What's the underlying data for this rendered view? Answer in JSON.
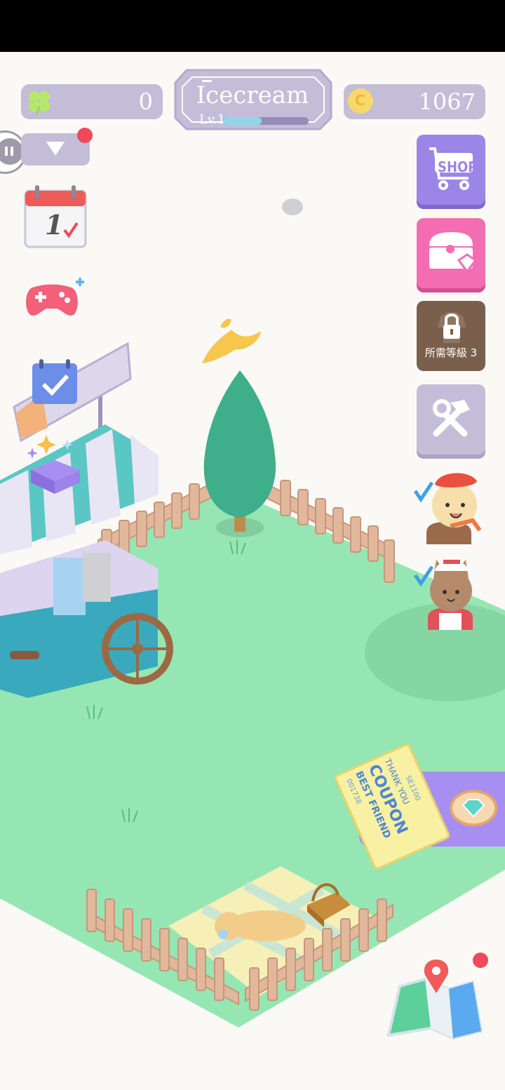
{
  "hud": {
    "clover_count": "0",
    "shop_name": "Icecream",
    "level_label": "Lv.1",
    "level_progress": 0.45,
    "coin_count": "1067",
    "coin_symbol": "C"
  },
  "side_buttons": {
    "calendar_day": "1",
    "shop_label": "SHOP",
    "wardrobe_lock_label": "所需等級 3"
  },
  "coupon": {
    "serial": "001738",
    "line1": "BEST FRIEND",
    "line2": "COUPON",
    "thanks": "THANK YOU",
    "code": "SE1100"
  },
  "colors": {
    "grass": "#96e6b3",
    "hud_purple": "#c4bdd8",
    "shop_button": "#9b85e6",
    "chest_button": "#f36db3",
    "wardrobe_button": "#7a5f4c",
    "tools_button": "#c4bdd8",
    "notification_dot": "#ef4a5b"
  }
}
